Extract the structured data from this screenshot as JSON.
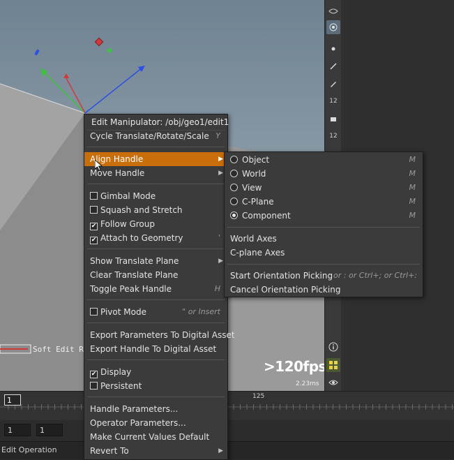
{
  "viewport": {
    "fps": ">120fps",
    "frame_time": "2.23ms",
    "soft_edit_label": "Soft Edit Ra"
  },
  "timeline": {
    "current_frame": "1",
    "tick_label": "125"
  },
  "playbar": {
    "start_frame": "1",
    "end_frame": "1"
  },
  "status": {
    "text": "Edit Operation"
  },
  "main_menu": {
    "header": "Edit Manipulator: /obj/geo1/edit1",
    "items": [
      {
        "label": "Cycle Translate/Rotate/Scale",
        "shortcut": "Y"
      },
      {
        "label": "Align Handle"
      },
      {
        "label": "Move Handle"
      },
      {
        "label": "Gimbal Mode"
      },
      {
        "label": "Squash and Stretch"
      },
      {
        "label": "Follow Group"
      },
      {
        "label": "Attach to Geometry",
        "shortcut": "'"
      },
      {
        "label": "Show Translate Plane"
      },
      {
        "label": "Clear Translate Plane"
      },
      {
        "label": "Toggle Peak Handle",
        "shortcut": "H"
      },
      {
        "label": "Pivot Mode",
        "shortcut": "\" or Insert"
      },
      {
        "label": "Export Parameters To Digital Asset"
      },
      {
        "label": "Export Handle To Digital Asset"
      },
      {
        "label": "Display"
      },
      {
        "label": "Persistent"
      },
      {
        "label": "Handle Parameters..."
      },
      {
        "label": "Operator Parameters..."
      },
      {
        "label": "Make Current Values Default"
      },
      {
        "label": "Revert To"
      }
    ]
  },
  "align_submenu": {
    "items": [
      {
        "label": "Object",
        "shortcut": "M"
      },
      {
        "label": "World",
        "shortcut": "M"
      },
      {
        "label": "View",
        "shortcut": "M"
      },
      {
        "label": "C-Plane",
        "shortcut": "M"
      },
      {
        "label": "Component",
        "shortcut": "M"
      },
      {
        "label": "World Axes"
      },
      {
        "label": "C-plane Axes"
      },
      {
        "label": "Start Orientation Picking",
        "shortcut": "; or : or Ctrl+; or Ctrl+:"
      },
      {
        "label": "Cancel Orientation Picking"
      }
    ]
  },
  "colors": {
    "highlight": "#c86e0a",
    "menu_bg": "#3b3b3b",
    "axis_x": "#d23a3a",
    "axis_y": "#3cc23c",
    "axis_z": "#2a4fe6"
  },
  "icons": {
    "toolbar": [
      "view-icon",
      "eye-drop-icon",
      "handle-icon",
      "dot-icon",
      "brush-icon",
      "pen-icon",
      "number-12-icon",
      "paint-icon",
      "layers-12-icon",
      "info-icon",
      "grid-icon",
      "eye-icon"
    ]
  }
}
